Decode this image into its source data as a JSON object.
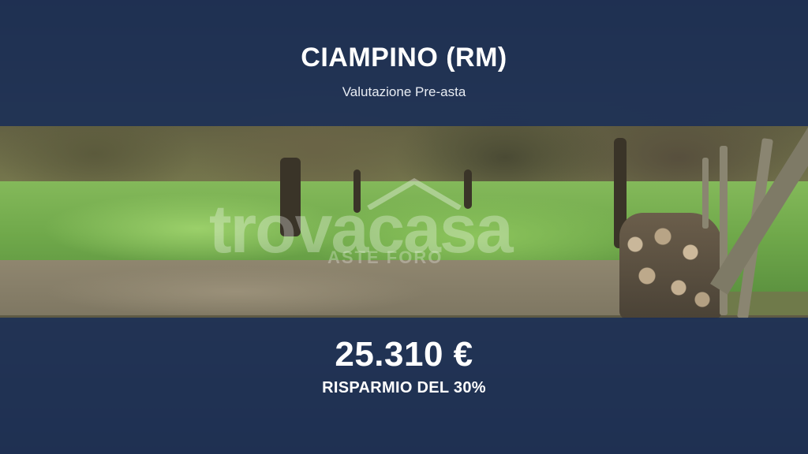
{
  "listing": {
    "location_title": "CIAMPINO (RM)",
    "subtitle": "Valutazione Pre-asta",
    "price": "25.310 €",
    "saving": "RISPARMIO DEL 30%"
  },
  "watermark": {
    "brand": "trovacasa",
    "tagline": "ASTE FORO"
  },
  "colors": {
    "overlay": "#1c3056",
    "text": "#ffffff"
  },
  "icons": {
    "watermark_roof": "house-roof-icon"
  }
}
